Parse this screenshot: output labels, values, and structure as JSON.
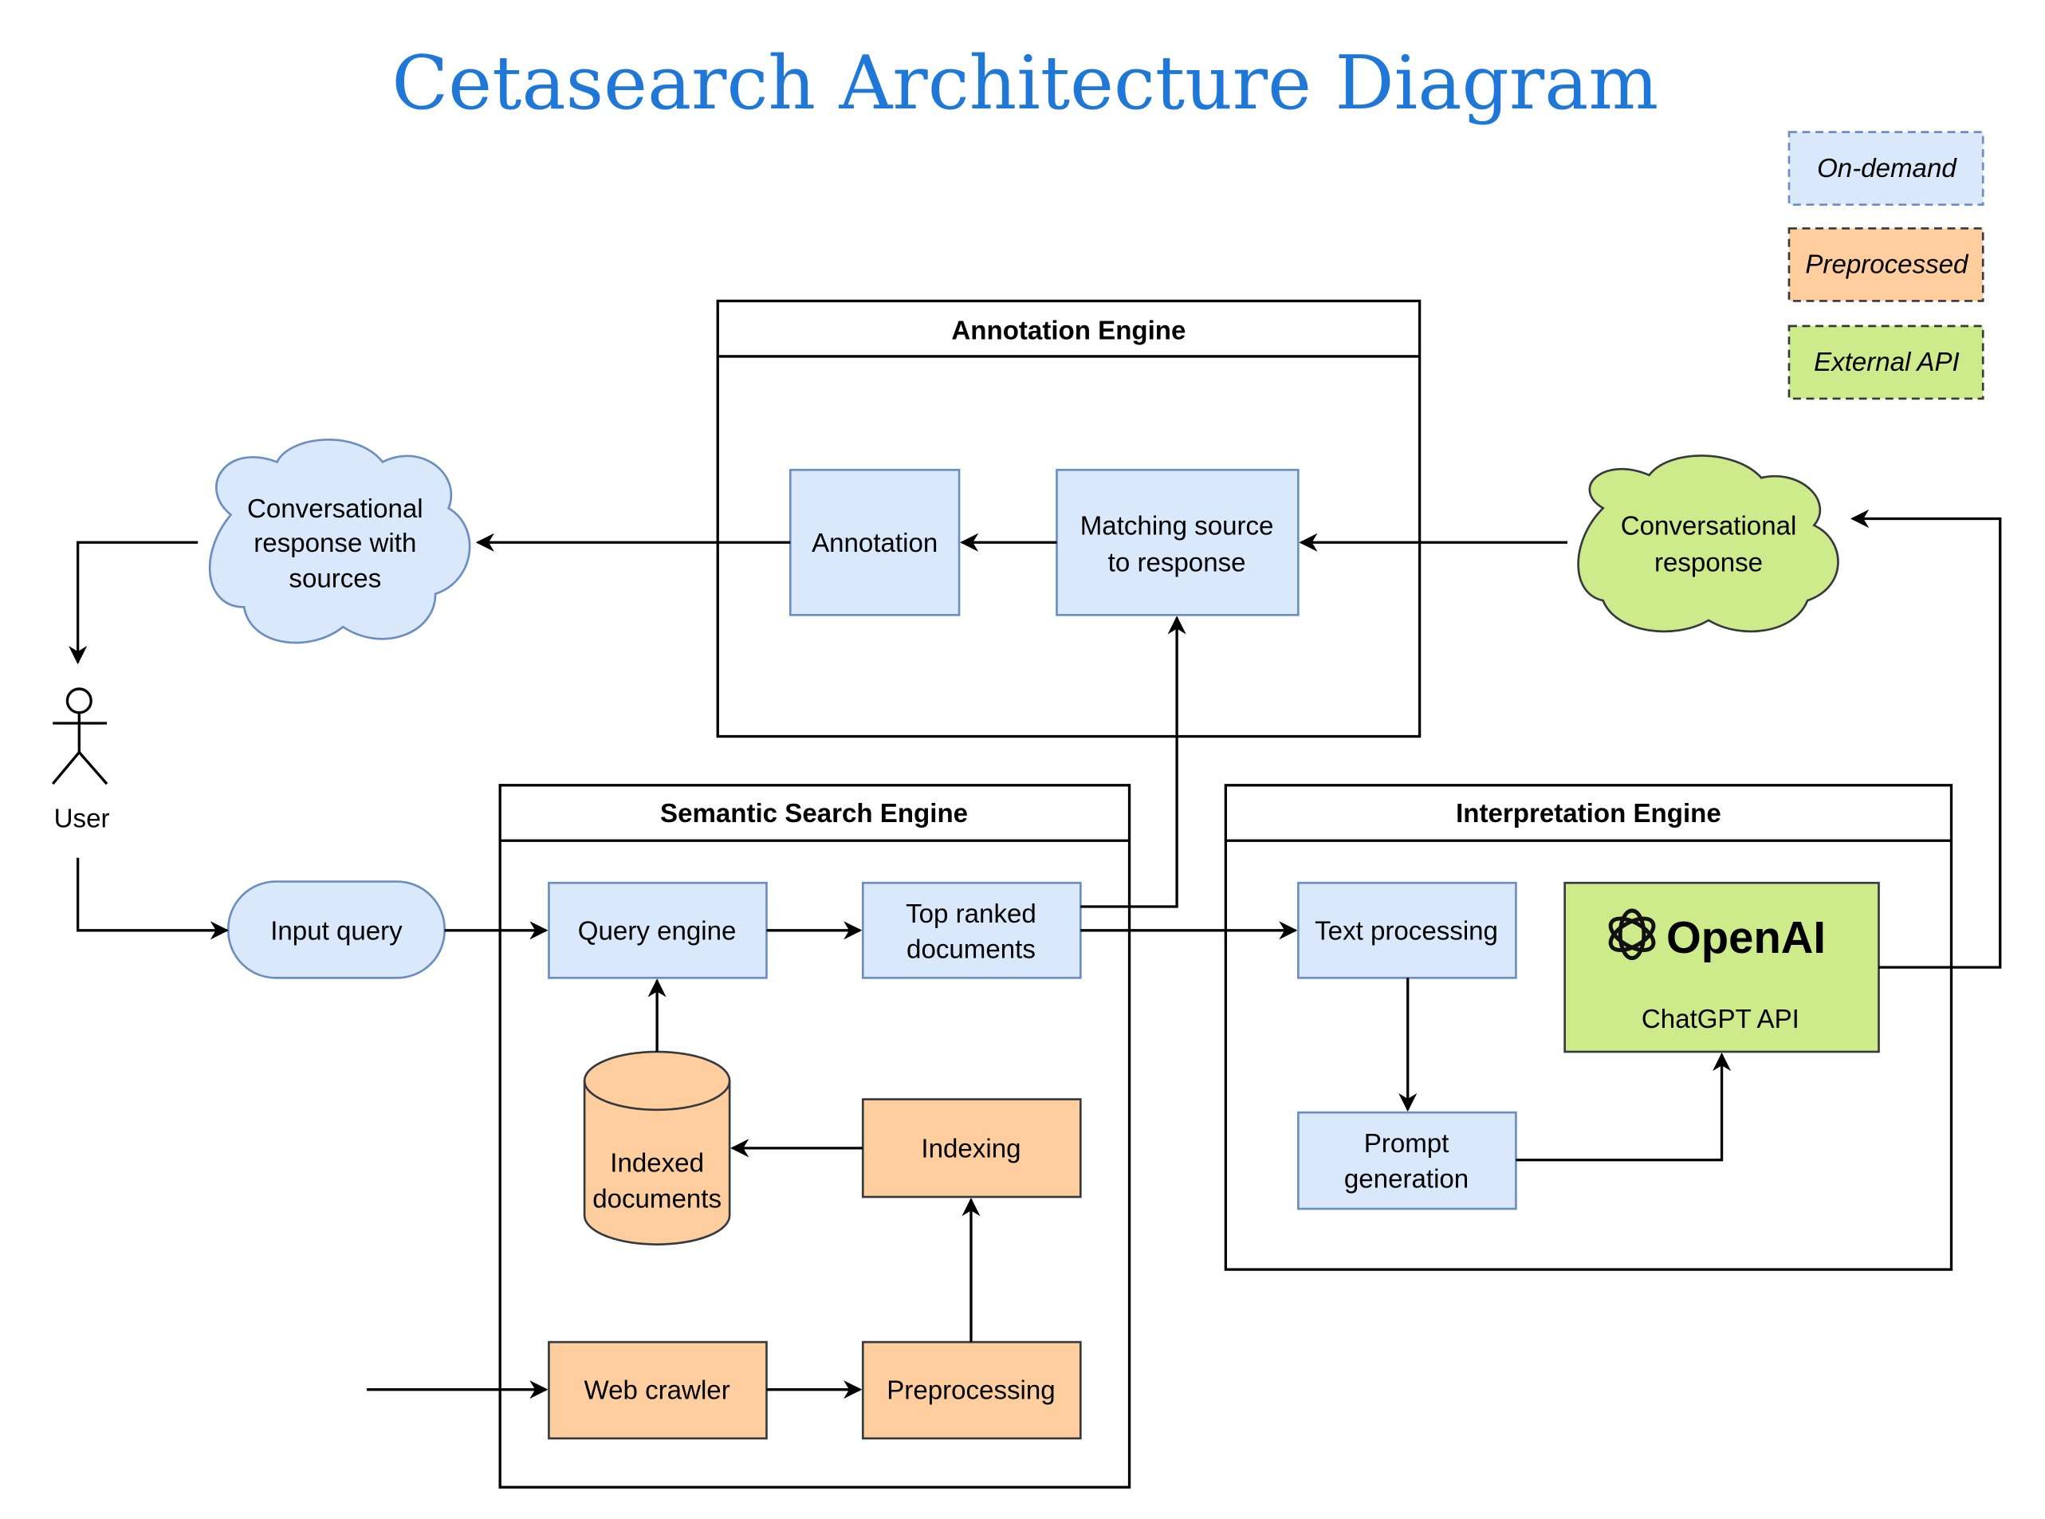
{
  "title": "Cetasearch Architecture Diagram",
  "legend": {
    "on_demand": "On-demand",
    "preprocessed": "Preprocessed",
    "external_api": "External API"
  },
  "colors": {
    "on_demand_fill": "#dae8fc",
    "on_demand_stroke": "#6c8ebf",
    "preprocessed_fill": "#ffce9f",
    "external_api_fill": "#cdeb8b",
    "title": "#1f78d8"
  },
  "user": {
    "label": "User"
  },
  "clouds": {
    "response_with_sources": [
      "Conversational",
      "response with",
      "sources"
    ],
    "conversational_response": [
      "Conversational",
      "response"
    ]
  },
  "annotation_engine": {
    "title": "Annotation Engine",
    "annotation": "Annotation",
    "matching": [
      "Matching source",
      "to response"
    ]
  },
  "semantic_search_engine": {
    "title": "Semantic Search Engine",
    "query_engine": "Query engine",
    "top_ranked": [
      "Top ranked",
      "documents"
    ],
    "indexed_documents": [
      "Indexed",
      "documents"
    ],
    "indexing": "Indexing",
    "web_crawler": "Web crawler",
    "preprocessing": "Preprocessing"
  },
  "input_query": "Input query",
  "interpretation_engine": {
    "title": "Interpretation Engine",
    "text_processing": "Text processing",
    "prompt_generation": [
      "Prompt",
      "generation"
    ],
    "openai_logo_text": "OpenAI",
    "chatgpt_api": "ChatGPT API"
  }
}
